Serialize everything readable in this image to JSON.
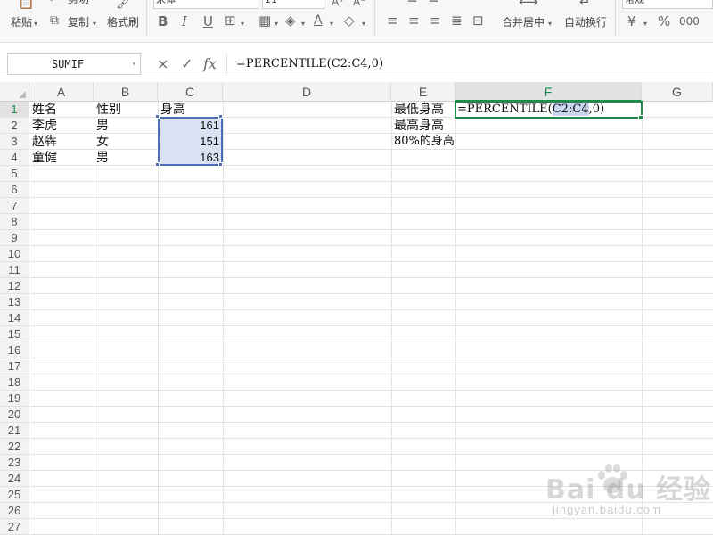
{
  "ribbon": {
    "cut": "剪切",
    "paste": "粘贴",
    "copy": "复制",
    "format_painter": "格式刷",
    "font_name": "宋体",
    "font_size": "11",
    "bold": "B",
    "italic": "I",
    "underline": "U",
    "merge_center": "合并居中",
    "wrap_text": "自动换行",
    "number_format": "常规",
    "currency_symbol": "¥",
    "percent_symbol": "%"
  },
  "formula_bar": {
    "name_box": "SUMIF",
    "cancel_icon": "×",
    "enter_icon": "✓",
    "fx_label": "fx",
    "formula": "=PERCENTILE(C2:C4,0)"
  },
  "columns": [
    "A",
    "B",
    "C",
    "D",
    "E",
    "F",
    "G"
  ],
  "rows": [
    "1",
    "2",
    "3",
    "4",
    "5",
    "6",
    "7",
    "8",
    "9",
    "10",
    "11",
    "12",
    "13",
    "14",
    "15",
    "16",
    "17",
    "18",
    "19",
    "20",
    "21",
    "22",
    "23",
    "24",
    "25",
    "26",
    "27"
  ],
  "cells": {
    "A1": "姓名",
    "B1": "性别",
    "C1": "身高",
    "A2": "李虎",
    "B2": "男",
    "C2": "161",
    "A3": "赵犇",
    "B3": "女",
    "C3": "151",
    "A4": "童健",
    "B4": "男",
    "C4": "163",
    "E1": "最低身高",
    "E2": "最高身高",
    "E3": "80%的身高"
  },
  "active_cell": {
    "prefix": "=PERCENTILE(",
    "ref": "C2:C4",
    "suffix": ",0)"
  },
  "colors": {
    "selection_green": "#1f8a4c",
    "range_blue": "#4a6fb5",
    "range_fill": "#d9e2f3"
  },
  "watermark": {
    "logo": "Bai du 经验",
    "url": "jingyan.baidu.com"
  }
}
